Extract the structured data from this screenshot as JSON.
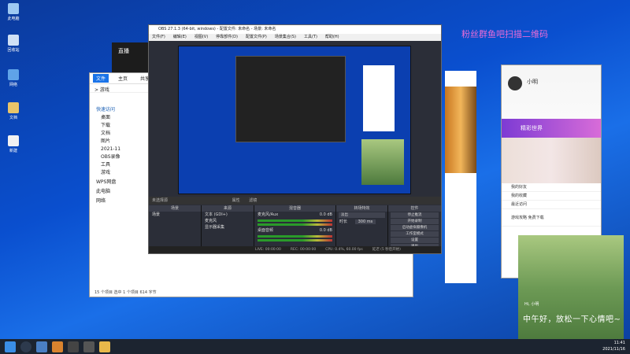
{
  "desktop": {
    "icons": [
      {
        "label": "此电脑",
        "color": "#9ec9f2"
      },
      {
        "label": "回收站",
        "color": "#cfe0f5"
      },
      {
        "label": "网络",
        "color": "#5fa3e8"
      },
      {
        "label": "文档",
        "color": "#e8c46a"
      },
      {
        "label": "新建",
        "color": "#f2f2f2"
      }
    ]
  },
  "promo_text": "粉丝群鱼吧扫描二维码",
  "explorer": {
    "tabs": [
      "文件",
      "主页",
      "共享"
    ],
    "address": "> 游戏",
    "nav_items": [
      "快速访问",
      "桌面",
      "下载",
      "文档",
      "图片",
      "2021-11",
      "OBS录像",
      "工具",
      "游戏",
      "WPS网盘",
      "此电脑",
      "网络"
    ],
    "status": "15 个项目    选中 1 个项目  614 字节"
  },
  "darkwin": {
    "label": "直播"
  },
  "obs": {
    "title": "OBS 27.1.3 (64-bit, windows) - 配置文件: 未命名 - 场景: 未命名",
    "menu": [
      "文件(F)",
      "编辑(E)",
      "视图(V)",
      "停靠部件(D)",
      "配置文件(P)",
      "场景集合(S)",
      "工具(T)",
      "帮助(H)"
    ],
    "preview_caption": "未选择源",
    "preview_buttons": [
      "属性",
      "滤镜"
    ],
    "scenes_header": "场景",
    "scenes": [
      "场景"
    ],
    "sources_header": "来源",
    "sources": [
      "文本 (GDI+)",
      "麦克风",
      "显示器采集"
    ],
    "mixer_header": "混音器",
    "mixer": [
      {
        "name": "麦克风/Aux",
        "db": "0.0 dB"
      },
      {
        "name": "桌面音频",
        "db": "0.0 dB"
      }
    ],
    "transitions_header": "转场特效",
    "transition_name": "淡出",
    "duration_label": "时长",
    "duration_value": "300 ms",
    "controls_header": "控件",
    "controls": [
      "停止推流",
      "开始录制",
      "启动虚拟摄像机",
      "工作室模式",
      "设置",
      "退出"
    ],
    "status": {
      "live": "LIVE: 00:00:00",
      "rec": "REC: 00:00:00",
      "cpu": "CPU: 0.4%, 60.00 fps",
      "delay": "延迟 (5 秒后开始)"
    }
  },
  "qq": {
    "name": "小明",
    "promo": "精彩世界",
    "list": [
      "我的好友",
      "我的收藏",
      "最近访问"
    ],
    "news": "游戏攻略 免费下载"
  },
  "notification": {
    "greeting": "Hi, 小明",
    "message": "中午好，放松一下心情吧~"
  },
  "taskbar": {
    "time": "11:41",
    "date": "2021/11/16"
  }
}
